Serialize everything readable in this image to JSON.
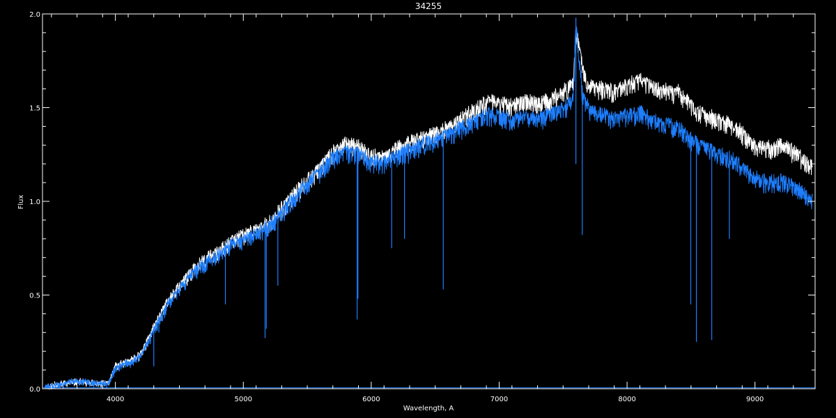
{
  "chart_data": {
    "type": "line",
    "title": "34255",
    "xlabel": "Wavelength, A",
    "ylabel": "Flux",
    "xlim": [
      3430,
      9470
    ],
    "ylim": [
      0.0,
      2.0
    ],
    "grid": false,
    "x_ticks": [
      4000,
      5000,
      6000,
      7000,
      8000,
      9000
    ],
    "x_tick_labels": [
      "4000",
      "5000",
      "6000",
      "7000",
      "8000",
      "9000"
    ],
    "y_ticks": [
      0.0,
      0.5,
      1.0,
      1.5,
      2.0
    ],
    "y_tick_labels": [
      "0.0",
      "0.5",
      "1.0",
      "1.5",
      "2.0"
    ],
    "colors": {
      "background": "#000000",
      "axes": "#ffffff",
      "series_1": "#ffffff",
      "series_2": "#1e7fff"
    },
    "series": [
      {
        "color": "#ffffff",
        "x": [
          3450,
          3600,
          3700,
          3850,
          3950,
          4000,
          4100,
          4200,
          4300,
          4400,
          4500,
          4600,
          4700,
          4800,
          4900,
          5000,
          5100,
          5200,
          5300,
          5400,
          5500,
          5600,
          5700,
          5800,
          5900,
          6000,
          6100,
          6200,
          6300,
          6400,
          6500,
          6600,
          6700,
          6800,
          6900,
          7000,
          7100,
          7200,
          7300,
          7400,
          7500,
          7580,
          7600,
          7650,
          7700,
          7800,
          7900,
          8000,
          8100,
          8200,
          8300,
          8400,
          8500,
          8600,
          8700,
          8800,
          8900,
          9000,
          9100,
          9200,
          9300,
          9400,
          9450
        ],
        "y": [
          0.02,
          0.04,
          0.05,
          0.04,
          0.04,
          0.14,
          0.16,
          0.2,
          0.35,
          0.48,
          0.58,
          0.66,
          0.72,
          0.76,
          0.82,
          0.85,
          0.88,
          0.92,
          1.0,
          1.08,
          1.15,
          1.22,
          1.3,
          1.34,
          1.33,
          1.28,
          1.27,
          1.32,
          1.35,
          1.38,
          1.4,
          1.43,
          1.48,
          1.52,
          1.57,
          1.56,
          1.55,
          1.57,
          1.56,
          1.58,
          1.62,
          1.68,
          1.95,
          1.75,
          1.65,
          1.64,
          1.62,
          1.66,
          1.68,
          1.65,
          1.63,
          1.62,
          1.55,
          1.5,
          1.48,
          1.45,
          1.4,
          1.33,
          1.32,
          1.34,
          1.3,
          1.25,
          1.22
        ]
      },
      {
        "color": "#1e7fff",
        "x": [
          3450,
          3600,
          3700,
          3850,
          3950,
          4000,
          4100,
          4200,
          4300,
          4400,
          4500,
          4600,
          4700,
          4800,
          4900,
          5000,
          5100,
          5200,
          5300,
          5400,
          5500,
          5600,
          5700,
          5800,
          5900,
          6000,
          6100,
          6200,
          6300,
          6400,
          6500,
          6600,
          6700,
          6800,
          6900,
          7000,
          7100,
          7200,
          7300,
          7400,
          7500,
          7580,
          7600,
          7650,
          7700,
          7800,
          7900,
          8000,
          8100,
          8200,
          8300,
          8400,
          8500,
          8600,
          8700,
          8800,
          8900,
          9000,
          9100,
          9200,
          9300,
          9400,
          9450
        ],
        "y": [
          0.02,
          0.04,
          0.05,
          0.04,
          0.04,
          0.13,
          0.15,
          0.19,
          0.33,
          0.46,
          0.56,
          0.64,
          0.7,
          0.74,
          0.8,
          0.83,
          0.86,
          0.9,
          0.98,
          1.06,
          1.13,
          1.2,
          1.27,
          1.3,
          1.29,
          1.25,
          1.24,
          1.28,
          1.31,
          1.34,
          1.36,
          1.39,
          1.43,
          1.46,
          1.5,
          1.49,
          1.47,
          1.49,
          1.48,
          1.5,
          1.53,
          1.58,
          1.98,
          1.62,
          1.53,
          1.5,
          1.48,
          1.5,
          1.51,
          1.48,
          1.45,
          1.43,
          1.37,
          1.32,
          1.3,
          1.27,
          1.22,
          1.16,
          1.14,
          1.15,
          1.12,
          1.08,
          1.05
        ]
      }
    ],
    "absorption_lines": {
      "x": [
        4300,
        4340,
        4860,
        5170,
        5180,
        5270,
        5890,
        5896,
        6160,
        6260,
        6563,
        7600,
        7650,
        8498,
        8542,
        8662,
        8800
      ],
      "y": [
        0.12,
        0.3,
        0.45,
        0.27,
        0.32,
        0.55,
        0.37,
        0.48,
        0.75,
        0.8,
        0.53,
        1.2,
        0.82,
        0.45,
        0.25,
        0.26,
        0.8
      ]
    }
  }
}
